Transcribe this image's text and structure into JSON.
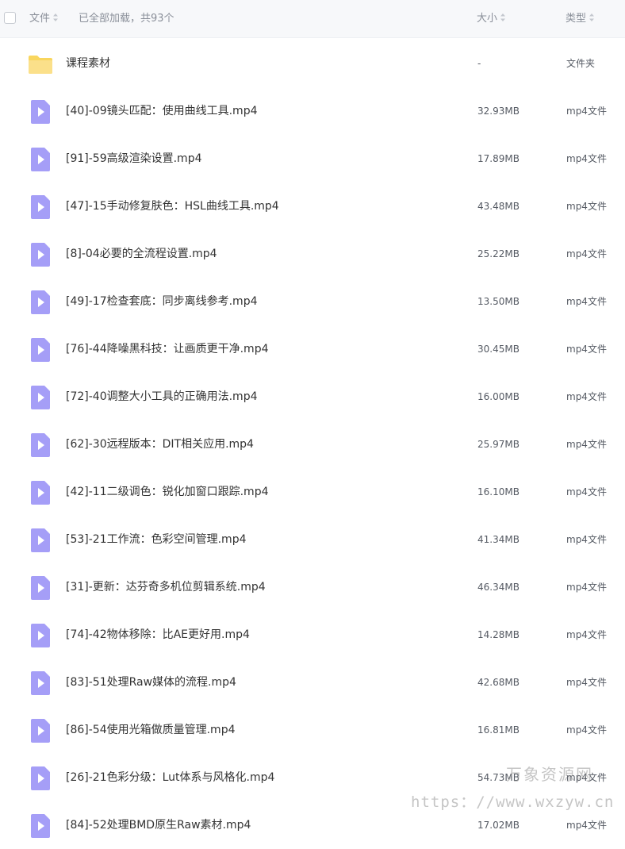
{
  "header": {
    "name_label": "文件",
    "status_text": "已全部加载，共93个",
    "size_label": "大小",
    "type_label": "类型"
  },
  "colors": {
    "folder": "#f9d65e",
    "video": "#a59ef7",
    "header_bg": "#f7f8fa"
  },
  "files": [
    {
      "name": "课程素材",
      "size": "-",
      "type": "文件夹",
      "icon": "folder-icon"
    },
    {
      "name": "[40]-09镜头匹配：使用曲线工具.mp4",
      "size": "32.93MB",
      "type": "mp4文件",
      "icon": "video-file-icon"
    },
    {
      "name": "[91]-59高级渲染设置.mp4",
      "size": "17.89MB",
      "type": "mp4文件",
      "icon": "video-file-icon"
    },
    {
      "name": "[47]-15手动修复肤色：HSL曲线工具.mp4",
      "size": "43.48MB",
      "type": "mp4文件",
      "icon": "video-file-icon"
    },
    {
      "name": "[8]-04必要的全流程设置.mp4",
      "size": "25.22MB",
      "type": "mp4文件",
      "icon": "video-file-icon"
    },
    {
      "name": "[49]-17检查套底：同步离线参考.mp4",
      "size": "13.50MB",
      "type": "mp4文件",
      "icon": "video-file-icon"
    },
    {
      "name": "[76]-44降噪黑科技：让画质更干净.mp4",
      "size": "30.45MB",
      "type": "mp4文件",
      "icon": "video-file-icon"
    },
    {
      "name": "[72]-40调整大小工具的正确用法.mp4",
      "size": "16.00MB",
      "type": "mp4文件",
      "icon": "video-file-icon"
    },
    {
      "name": "[62]-30远程版本：DIT相关应用.mp4",
      "size": "25.97MB",
      "type": "mp4文件",
      "icon": "video-file-icon"
    },
    {
      "name": "[42]-11二级调色：锐化加窗口跟踪.mp4",
      "size": "16.10MB",
      "type": "mp4文件",
      "icon": "video-file-icon"
    },
    {
      "name": "[53]-21工作流：色彩空间管理.mp4",
      "size": "41.34MB",
      "type": "mp4文件",
      "icon": "video-file-icon"
    },
    {
      "name": "[31]-更新：达芬奇多机位剪辑系统.mp4",
      "size": "46.34MB",
      "type": "mp4文件",
      "icon": "video-file-icon"
    },
    {
      "name": "[74]-42物体移除：比AE更好用.mp4",
      "size": "14.28MB",
      "type": "mp4文件",
      "icon": "video-file-icon"
    },
    {
      "name": "[83]-51处理Raw媒体的流程.mp4",
      "size": "42.68MB",
      "type": "mp4文件",
      "icon": "video-file-icon"
    },
    {
      "name": "[86]-54使用光箱做质量管理.mp4",
      "size": "16.81MB",
      "type": "mp4文件",
      "icon": "video-file-icon"
    },
    {
      "name": "[26]-21色彩分级：Lut体系与风格化.mp4",
      "size": "54.73MB",
      "type": "mp4文件",
      "icon": "video-file-icon"
    },
    {
      "name": "[84]-52处理BMD原生Raw素材.mp4",
      "size": "17.02MB",
      "type": "mp4文件",
      "icon": "video-file-icon"
    }
  ],
  "watermark": {
    "line1": "万象资源网",
    "line2": "https：//www.wxzyw.cn"
  }
}
